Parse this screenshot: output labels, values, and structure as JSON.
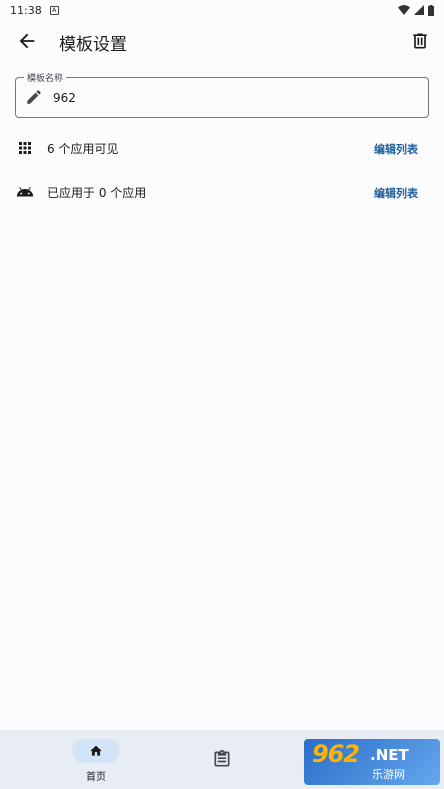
{
  "status_bar": {
    "time": "11:38",
    "notification_glyph": "A"
  },
  "app_bar": {
    "title": "模板设置"
  },
  "template_name_field": {
    "label": "模板名称",
    "value": "962"
  },
  "rows": [
    {
      "label": "6 个应用可见",
      "action": "编辑列表",
      "icon": "apps-grid-icon"
    },
    {
      "label": "已应用于 0 个应用",
      "action": "编辑列表",
      "icon": "android-icon"
    }
  ],
  "bottom_nav": {
    "items": [
      {
        "label": "首页",
        "icon": "home-icon",
        "selected": true
      },
      {
        "label": "",
        "icon": "clipboard-list-icon",
        "selected": false
      }
    ]
  },
  "watermark": {
    "logo_text": "962",
    "suffix": ".NET",
    "sub": "乐游网"
  },
  "colors": {
    "background": "#fcfcff",
    "accent": "#1d5f9a",
    "nav_background": "#e7ecf5",
    "nav_indicator": "#d3e3f8"
  }
}
